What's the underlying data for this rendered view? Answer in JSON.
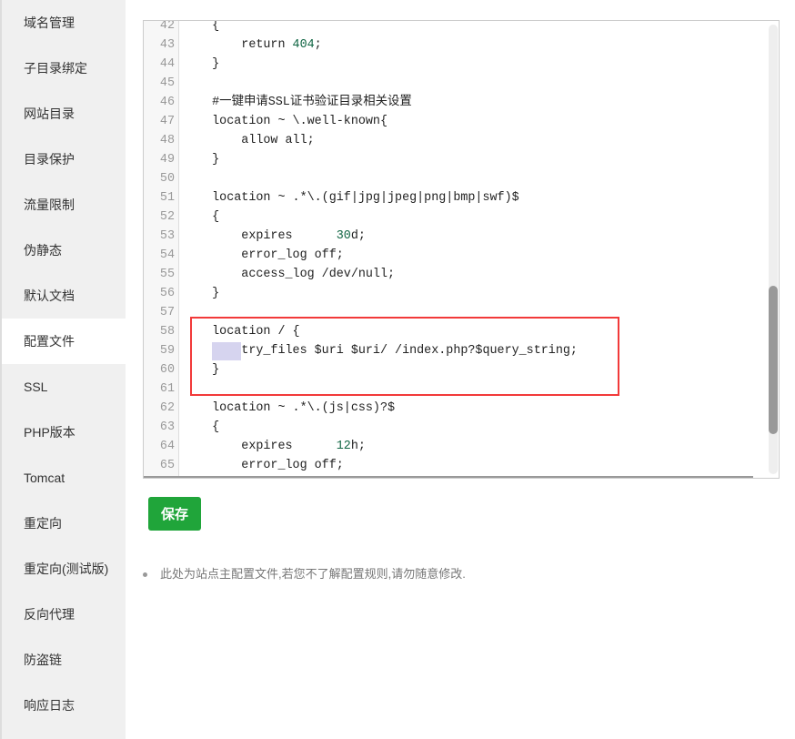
{
  "sidebar": {
    "active_index": 7,
    "items": [
      {
        "label": "域名管理"
      },
      {
        "label": "子目录绑定"
      },
      {
        "label": "网站目录"
      },
      {
        "label": "目录保护"
      },
      {
        "label": "流量限制"
      },
      {
        "label": "伪静态"
      },
      {
        "label": "默认文档"
      },
      {
        "label": "配置文件"
      },
      {
        "label": "SSL"
      },
      {
        "label": "PHP版本"
      },
      {
        "label": "Tomcat"
      },
      {
        "label": "重定向"
      },
      {
        "label": "重定向(测试版)"
      },
      {
        "label": "反向代理"
      },
      {
        "label": "防盗链"
      },
      {
        "label": "响应日志"
      }
    ]
  },
  "editor": {
    "lines": [
      {
        "n": "42",
        "text": "    {"
      },
      {
        "n": "43",
        "text": "        return ",
        "num": "404",
        "after": ";"
      },
      {
        "n": "44",
        "text": "    }"
      },
      {
        "n": "45",
        "text": ""
      },
      {
        "n": "46",
        "text": "    #一键申请SSL证书验证目录相关设置"
      },
      {
        "n": "47",
        "text": "    location ~ \\.well-known{"
      },
      {
        "n": "48",
        "text": "        allow all;"
      },
      {
        "n": "49",
        "text": "    }"
      },
      {
        "n": "50",
        "text": ""
      },
      {
        "n": "51",
        "text": "    location ~ .*\\.(gif|jpg|jpeg|png|bmp|swf)$"
      },
      {
        "n": "52",
        "text": "    {"
      },
      {
        "n": "53",
        "text": "        expires      ",
        "num": "30",
        "after": "d;"
      },
      {
        "n": "54",
        "text": "        error_log off;"
      },
      {
        "n": "55",
        "text": "        access_log /dev/null;"
      },
      {
        "n": "56",
        "text": "    }"
      },
      {
        "n": "57",
        "text": ""
      },
      {
        "n": "58",
        "text": "    location / {"
      },
      {
        "n": "59",
        "text": "        try_files $uri $uri/ /index.php?$query_string;"
      },
      {
        "n": "60",
        "text": "    }"
      },
      {
        "n": "61",
        "text": ""
      },
      {
        "n": "62",
        "text": "    location ~ .*\\.(js|css)?$"
      },
      {
        "n": "63",
        "text": "    {"
      },
      {
        "n": "64",
        "text": "        expires      ",
        "num": "12",
        "after": "h;"
      },
      {
        "n": "65",
        "text": "        error_log off;"
      }
    ],
    "selected_line": "59",
    "highlight_color": "#f23a3a"
  },
  "save_label": "保存",
  "tip": "此处为站点主配置文件,若您不了解配置规则,请勿随意修改.",
  "colors": {
    "accent": "#20a53a",
    "number": "#116644"
  }
}
